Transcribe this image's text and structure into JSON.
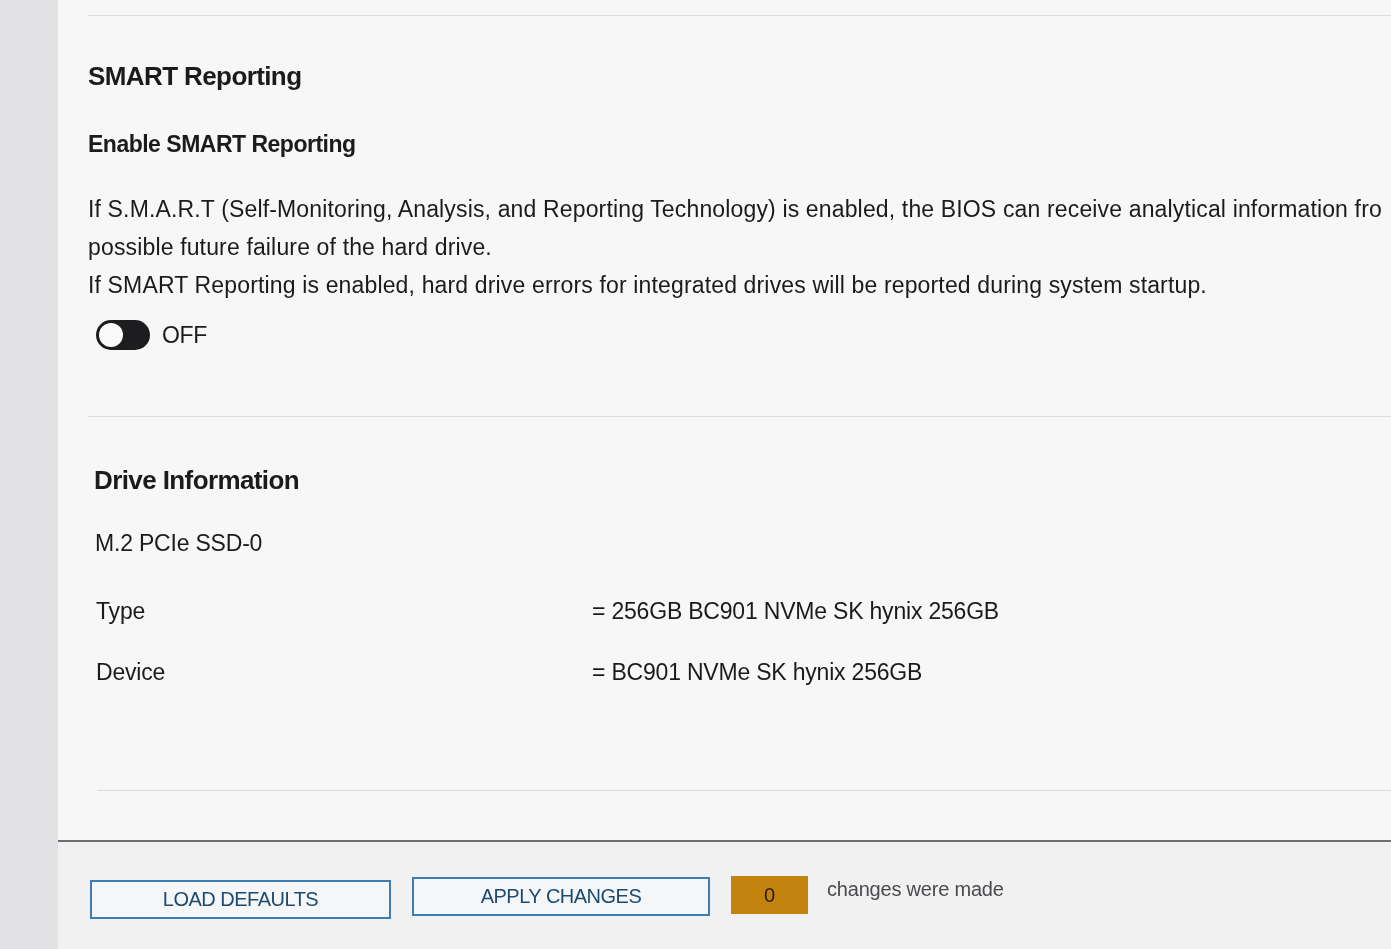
{
  "smart_reporting": {
    "title": "SMART Reporting",
    "setting": {
      "label": "Enable SMART Reporting",
      "description": [
        "If S.M.A.R.T (Self-Monitoring, Analysis, and Reporting Technology) is enabled, the BIOS can receive analytical information fro",
        "possible future failure of the hard drive.",
        "If SMART Reporting is enabled, hard drive errors for integrated drives will be reported during system startup."
      ],
      "toggle": {
        "on": false,
        "label": "OFF"
      }
    }
  },
  "drive_information": {
    "title": "Drive Information",
    "drive": "M.2 PCIe SSD-0",
    "rows": [
      {
        "label": "Type",
        "value": "= 256GB BC901 NVMe SK hynix 256GB"
      },
      {
        "label": "Device",
        "value": "= BC901 NVMe SK hynix 256GB"
      }
    ]
  },
  "footer": {
    "buttons": [
      "LOAD DEFAULTS",
      "APPLY CHANGES"
    ],
    "change_count": "0",
    "change_text": "changes were made"
  }
}
